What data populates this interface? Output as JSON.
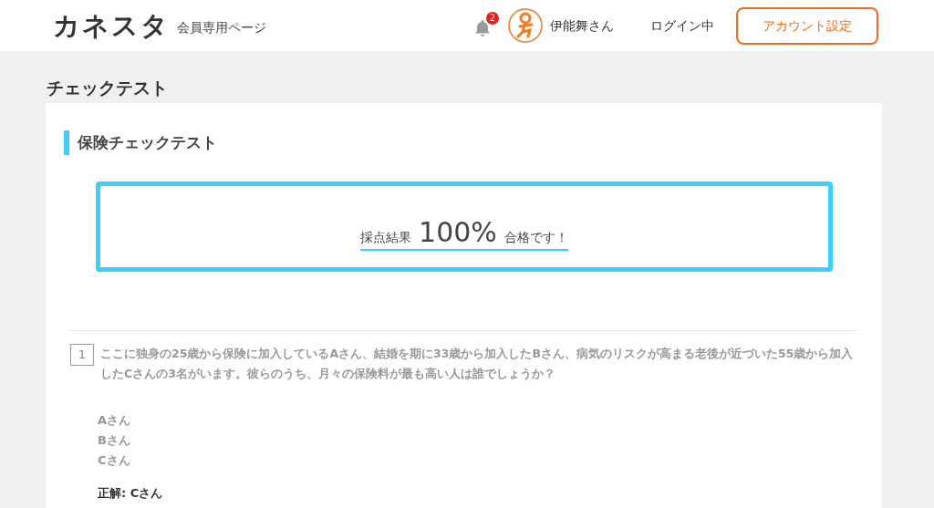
{
  "header": {
    "logo": "カネスタ",
    "subtitle": "会員専用ページ",
    "notification_count": "2",
    "user_name": "伊能舞さん",
    "login_status": "ログイン中",
    "account_button": "アカウント設定"
  },
  "page_title": "チェックテスト",
  "section_title": "保険チェックテスト",
  "result": {
    "label": "採点結果",
    "score": "100%",
    "message": "合格です！"
  },
  "questions": [
    {
      "number": "1",
      "text": "ここに独身の25歳から保険に加入しているAさん、結婚を期に33歳から加入したBさん、病気のリスクが高まる老後が近づいた55歳から加入したCさんの3名がいます。彼らのうち、月々の保険料が最も高い人は誰でしょうか？",
      "options": [
        "Aさん",
        "Bさん",
        "Cさん"
      ],
      "answer": "正解: Cさん"
    }
  ]
}
